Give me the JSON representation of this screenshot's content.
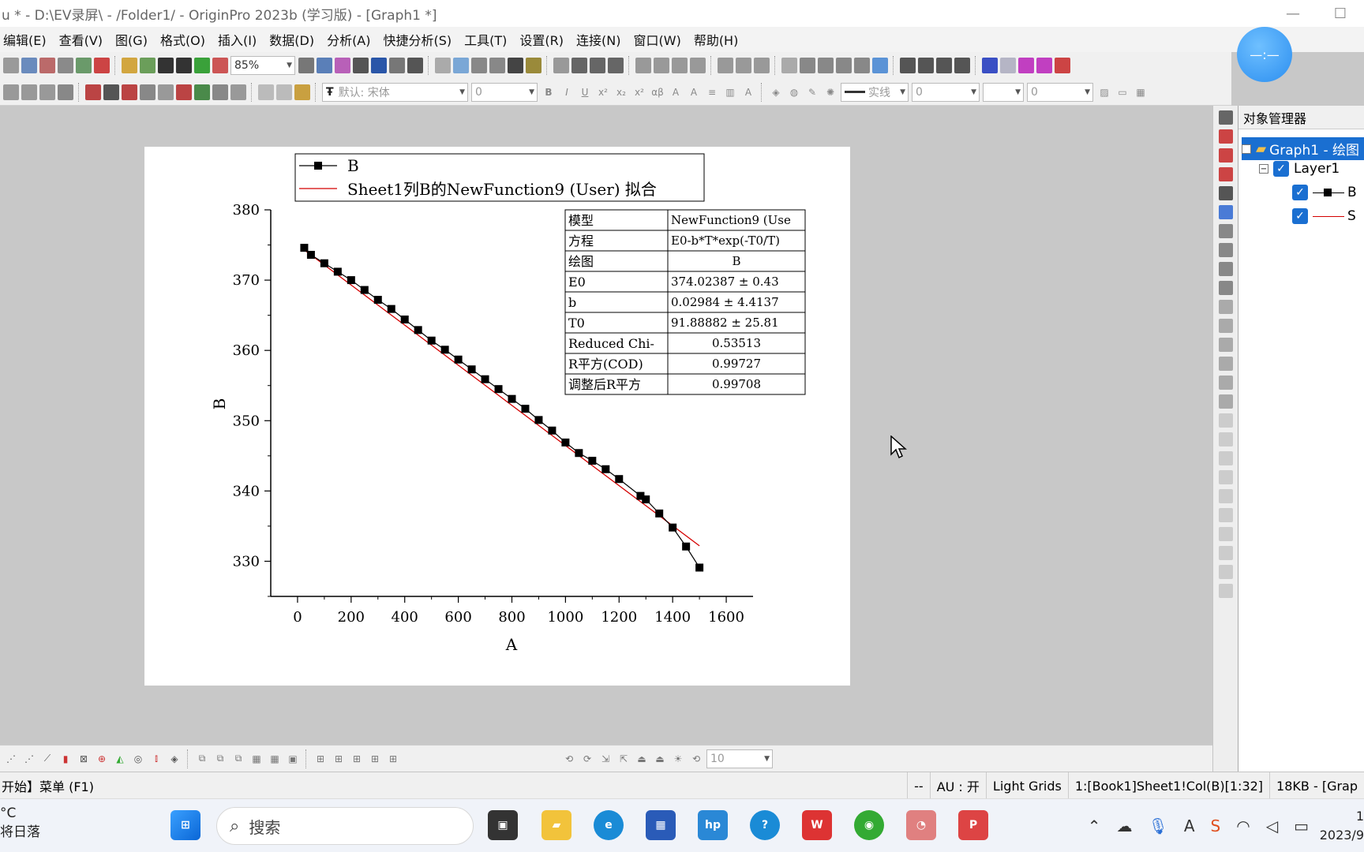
{
  "window": {
    "title": "u * - D:\\EV录屏\\ - /Folder1/ - OriginPro 2023b (学习版) - [Graph1 *]",
    "minimize": "—",
    "restore": "☐"
  },
  "menu": [
    "编辑(E)",
    "查看(V)",
    "图(G)",
    "格式(O)",
    "插入(I)",
    "数据(D)",
    "分析(A)",
    "快捷分析(S)",
    "工具(T)",
    "设置(R)",
    "连接(N)",
    "窗口(W)",
    "帮助(H)"
  ],
  "toolbar": {
    "zoom": "85%",
    "font_name": "默认: 宋体",
    "font_size": "0",
    "line_style": "实线",
    "line_width": "0",
    "fill_value": "0",
    "bottom_size": "10"
  },
  "float_widget": "—:—",
  "graph": {
    "legend": [
      "B",
      "Sheet1列B的NewFunction9 (User) 拟合"
    ],
    "stats_table": [
      [
        "模型",
        "NewFunction9 (Use"
      ],
      [
        "方程",
        "E0-b*T*exp(-T0/T)"
      ],
      [
        "绘图",
        "B"
      ],
      [
        "E0",
        "374.02387 ± 0.43"
      ],
      [
        "b",
        "0.02984 ± 4.4137"
      ],
      [
        "T0",
        "91.88882 ± 25.81"
      ],
      [
        "Reduced Chi-",
        "0.53513"
      ],
      [
        "R平方(COD)",
        "0.99727"
      ],
      [
        "调整后R平方",
        "0.99708"
      ]
    ]
  },
  "chart_data": {
    "type": "scatter",
    "xlabel": "A",
    "ylabel": "B",
    "xlim": [
      -100,
      1700
    ],
    "ylim": [
      325,
      380
    ],
    "xticks": [
      0,
      200,
      400,
      600,
      800,
      1000,
      1200,
      1400,
      1600
    ],
    "yticks": [
      330,
      340,
      350,
      360,
      370,
      380
    ],
    "series": [
      {
        "name": "B",
        "marker": "square",
        "color": "#000000",
        "x": [
          25,
          50,
          100,
          150,
          200,
          250,
          300,
          350,
          400,
          450,
          500,
          550,
          600,
          650,
          700,
          750,
          800,
          850,
          900,
          950,
          1000,
          1050,
          1100,
          1150,
          1200,
          1280,
          1300,
          1350,
          1400,
          1450,
          1500
        ],
        "y": [
          374.6,
          373.6,
          372.4,
          371.2,
          370.0,
          368.6,
          367.2,
          365.9,
          364.4,
          362.9,
          361.4,
          360.1,
          358.7,
          357.3,
          355.9,
          354.5,
          353.1,
          351.7,
          350.1,
          348.6,
          346.9,
          345.4,
          344.3,
          343.1,
          341.7,
          339.3,
          338.8,
          336.8,
          334.8,
          332.1,
          329.1
        ]
      },
      {
        "name": "Sheet1列B的NewFunction9 (User) 拟合",
        "color": "#d40000",
        "x": [
          25,
          1500
        ],
        "y": [
          374.3,
          332.2
        ]
      }
    ]
  },
  "object_manager": {
    "title": "对象管理器",
    "graph_item": "Graph1 - 绘图",
    "layer_item": "Layer1",
    "plot1": "B",
    "plot2": "S"
  },
  "status": {
    "left": "开始】菜单 (F1)",
    "cells": [
      "--",
      "AU : 开",
      "Light Grids",
      "1:[Book1]Sheet1!Col(B)[1:32]",
      "18KB - [Grap"
    ]
  },
  "taskbar": {
    "weather_temp": "°C",
    "weather_desc": "将日落",
    "search_placeholder": "搜索",
    "time": "1",
    "date": "2023/9"
  }
}
